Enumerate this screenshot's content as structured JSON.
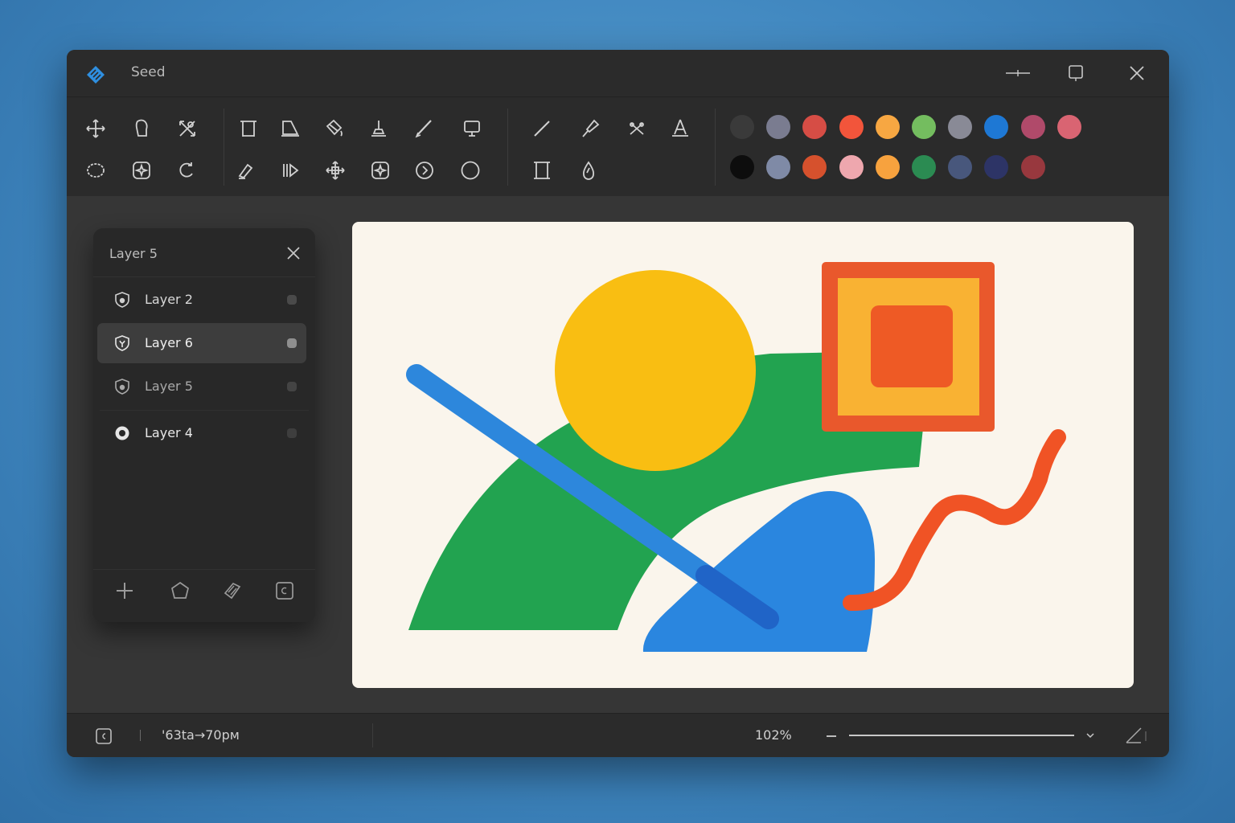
{
  "app": {
    "title": "Seed",
    "accent": "#2f8fe0"
  },
  "window_controls": [
    "minimize-icon",
    "maximize-icon",
    "close-icon"
  ],
  "tools": {
    "group1": [
      "move",
      "lasso",
      "transform",
      "ellipse-select",
      "magic-wand",
      "rotate"
    ],
    "group2": [
      "crop",
      "perspective",
      "fill-bucket",
      "stamp",
      "brush",
      "frame",
      "eraser",
      "gradient",
      "arrange",
      "clone",
      "play-circle",
      "circle"
    ],
    "group3": [
      "line",
      "pen",
      "scissors",
      "text-path",
      "rectangle",
      "drop"
    ]
  },
  "palette": {
    "row1": [
      "#3a3a3a",
      "#7a7c90",
      "#d64d45",
      "#f2553b",
      "#f7a742",
      "#74bd5f",
      "#898a96",
      "#1e78d4",
      "#b04a6a",
      "#d96472"
    ],
    "row2": [
      "#0d0d0d",
      "#7f8aa6",
      "#d6512d",
      "#eea7ae",
      "#f7a23e",
      "#2b8b52",
      "#48577c",
      "#2d3466",
      "#98383e"
    ]
  },
  "layers_panel": {
    "title": "Layer 5",
    "layers": [
      {
        "name": "Layer 2",
        "active": false
      },
      {
        "name": "Layer 6",
        "active": true
      },
      {
        "name": "Layer 5",
        "active": false
      },
      {
        "name": "Layer 4",
        "active": false
      }
    ],
    "actions": [
      "add-layer",
      "shape-layer",
      "link-layer",
      "duplicate-layer"
    ]
  },
  "status": {
    "info": "'63ta→70pм",
    "zoom": "102%"
  }
}
